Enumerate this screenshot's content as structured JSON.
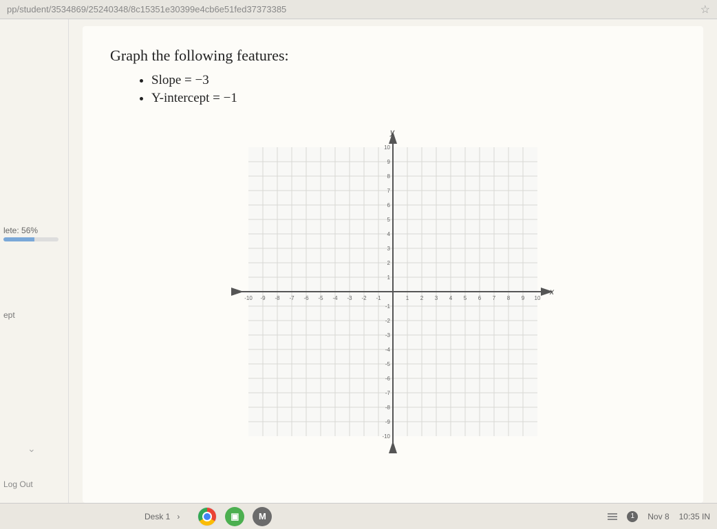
{
  "url": "pp/student/3534869/25240348/8c15351e30399e4cb6e51fed37373385",
  "sidebar": {
    "complete_label": "lete: 56%",
    "progress_pct": 56,
    "ept_label": "ept",
    "logout_label": "Log Out"
  },
  "question": {
    "title": "Graph the following features:",
    "bullets": [
      "Slope = −3",
      "Y-intercept = −1"
    ]
  },
  "chart_data": {
    "type": "scatter",
    "title": "",
    "xlabel": "x",
    "ylabel": "y",
    "xlim": [
      -10,
      10
    ],
    "ylim": [
      -10,
      10
    ],
    "x_ticks": [
      -10,
      -9,
      -8,
      -7,
      -6,
      -5,
      -4,
      -3,
      -2,
      -1,
      1,
      2,
      3,
      4,
      5,
      6,
      7,
      8,
      9,
      10
    ],
    "y_ticks": [
      -10,
      -9,
      -8,
      -7,
      -6,
      -5,
      -4,
      -3,
      -2,
      -1,
      1,
      2,
      3,
      4,
      5,
      6,
      7,
      8,
      9,
      10
    ],
    "series": []
  },
  "taskbar": {
    "desk_label": "Desk 1",
    "chevron": "›",
    "m_label": "M",
    "notif_count": "1",
    "date_label": "Nov 8",
    "time_label": "10:35 IN"
  }
}
